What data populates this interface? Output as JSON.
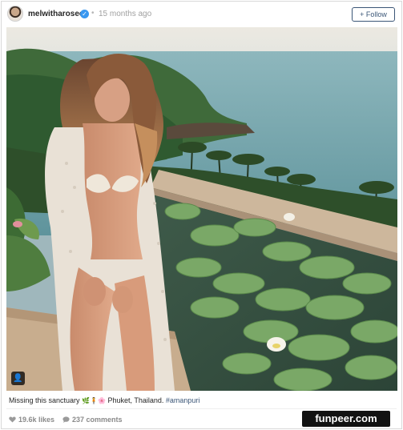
{
  "post": {
    "username": "melwitharosee",
    "separator": "•",
    "time_ago": "15 months ago",
    "follow_label": "+ Follow"
  },
  "caption": {
    "text": "Missing this sanctuary",
    "emoji": "🌿🧍🌸",
    "location": "Phuket, Thailand.",
    "hashtag": "#amanpuri"
  },
  "stats": {
    "likes": "19.6k likes",
    "comments": "237 comments"
  },
  "watermark": "funpeer.com",
  "icons": {
    "verified": "verified-badge-icon",
    "user_tag": "user-tag-icon",
    "heart": "heart-icon",
    "comment": "comment-icon"
  },
  "colors": {
    "verified": "#3897f0",
    "follow_border": "#3b5677",
    "hashtag": "#3b5677",
    "sea": "#6f9ea7",
    "lily_pad": "#7aa867"
  }
}
